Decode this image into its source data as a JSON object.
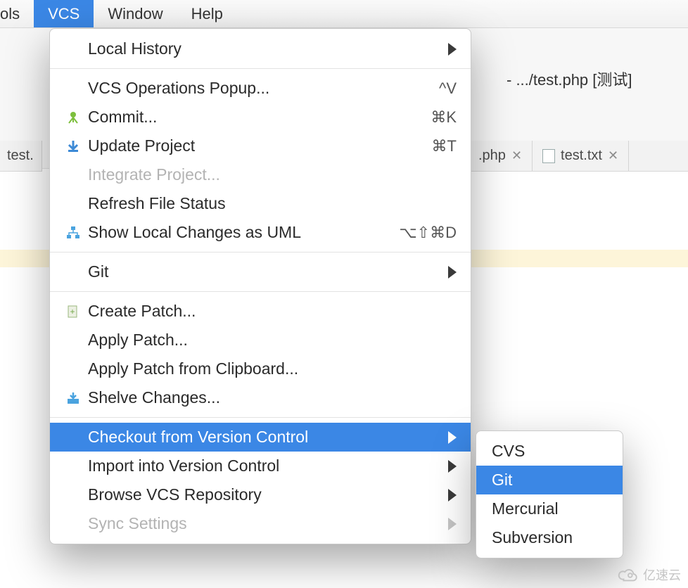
{
  "menubar": {
    "items": [
      {
        "label": "ols",
        "selected": false,
        "partial": true
      },
      {
        "label": "VCS",
        "selected": true
      },
      {
        "label": "Window",
        "selected": false
      },
      {
        "label": "Help",
        "selected": false
      }
    ]
  },
  "breadcrumb": {
    "text": "- .../test.php [测试]"
  },
  "tabs": {
    "left_fragment": "test.",
    "items": [
      {
        "label": ".php"
      },
      {
        "label": "test.txt"
      }
    ]
  },
  "menu": {
    "groups": [
      [
        {
          "label": "Local History",
          "submenu": true
        }
      ],
      [
        {
          "label": "VCS Operations Popup...",
          "shortcut": "^V"
        },
        {
          "label": "Commit...",
          "shortcut": "⌘K",
          "icon": "commit"
        },
        {
          "label": "Update Project",
          "shortcut": "⌘T",
          "icon": "update"
        },
        {
          "label": "Integrate Project...",
          "disabled": true
        },
        {
          "label": "Refresh File Status"
        },
        {
          "label": "Show Local Changes as UML",
          "shortcut": "⌥⇧⌘D",
          "icon": "diagram"
        }
      ],
      [
        {
          "label": "Git",
          "submenu": true
        }
      ],
      [
        {
          "label": "Create Patch...",
          "icon": "patch"
        },
        {
          "label": "Apply Patch..."
        },
        {
          "label": "Apply Patch from Clipboard..."
        },
        {
          "label": "Shelve Changes...",
          "icon": "shelve"
        }
      ],
      [
        {
          "label": "Checkout from Version Control",
          "submenu": true,
          "selected": true
        },
        {
          "label": "Import into Version Control",
          "submenu": true
        },
        {
          "label": "Browse VCS Repository",
          "submenu": true
        },
        {
          "label": "Sync Settings",
          "submenu": true,
          "disabled": true
        }
      ]
    ]
  },
  "submenu": {
    "items": [
      {
        "label": "CVS"
      },
      {
        "label": "Git",
        "selected": true
      },
      {
        "label": "Mercurial"
      },
      {
        "label": "Subversion"
      }
    ]
  },
  "watermark": {
    "text": "亿速云"
  }
}
